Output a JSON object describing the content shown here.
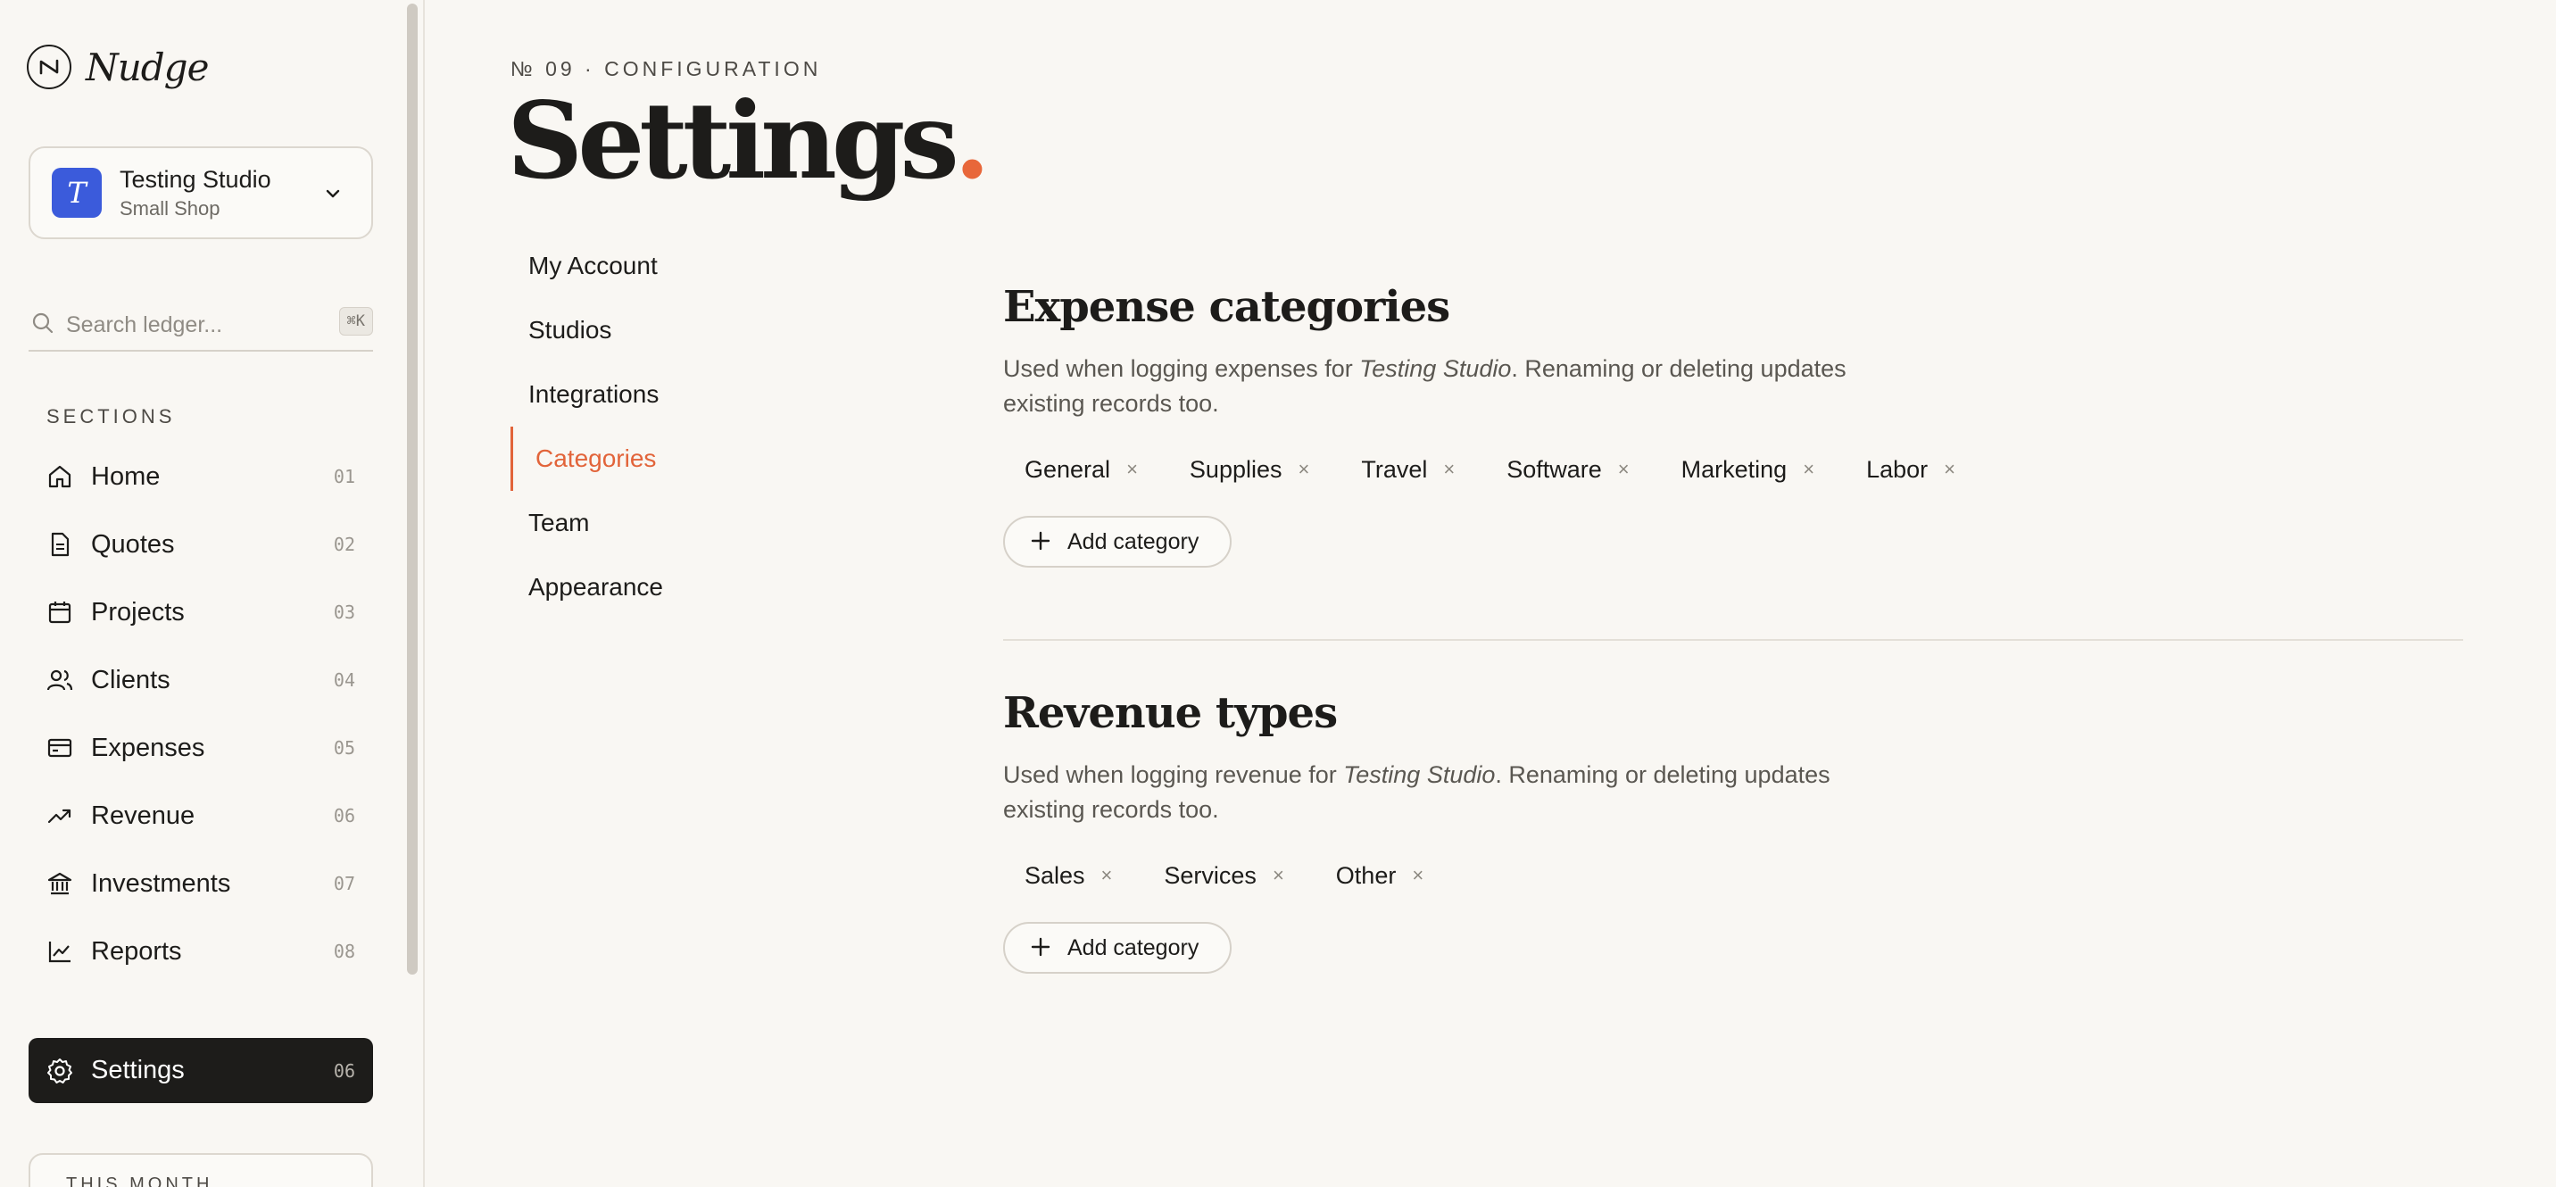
{
  "sidebar": {
    "brand": "Nudge",
    "studio": {
      "name": "Testing Studio",
      "plan": "Small Shop",
      "avatar_letter": "T",
      "avatar_color": "#3b5bdb"
    },
    "search": {
      "placeholder": "Search ledger...",
      "shortcut": "⌘K"
    },
    "sections_label": "SECTIONS",
    "items": [
      {
        "label": "Home",
        "num": "01",
        "icon": "home-icon"
      },
      {
        "label": "Quotes",
        "num": "02",
        "icon": "document-icon"
      },
      {
        "label": "Projects",
        "num": "03",
        "icon": "calendar-icon"
      },
      {
        "label": "Clients",
        "num": "04",
        "icon": "users-icon"
      },
      {
        "label": "Expenses",
        "num": "05",
        "icon": "card-icon"
      },
      {
        "label": "Revenue",
        "num": "06",
        "icon": "trend-up-icon"
      },
      {
        "label": "Investments",
        "num": "07",
        "icon": "bank-icon"
      },
      {
        "label": "Reports",
        "num": "08",
        "icon": "line-chart-icon"
      }
    ],
    "settings": {
      "label": "Settings",
      "num": "06",
      "icon": "gear-icon"
    },
    "month_label": "THIS MONTH"
  },
  "header": {
    "eyebrow": "№ 09 · CONFIGURATION",
    "title": "Settings",
    "title_dot": ".",
    "accent": "#e8673a"
  },
  "subnav": {
    "items": [
      "My Account",
      "Studios",
      "Integrations",
      "Categories",
      "Team",
      "Appearance"
    ],
    "active": "Categories"
  },
  "expense": {
    "title": "Expense categories",
    "desc_before": "Used when logging expenses for ",
    "desc_studio": "Testing Studio",
    "desc_after": ". Renaming or deleting updates existing records too.",
    "chips": [
      "General",
      "Supplies",
      "Travel",
      "Software",
      "Marketing",
      "Labor"
    ],
    "add_label": "Add category"
  },
  "revenue": {
    "title": "Revenue types",
    "desc_before": "Used when logging revenue for ",
    "desc_studio": "Testing Studio",
    "desc_after": ". Renaming or deleting updates existing records too.",
    "chips": [
      "Sales",
      "Services",
      "Other"
    ],
    "add_label": "Add category"
  },
  "chip_remove_glyph": "×"
}
